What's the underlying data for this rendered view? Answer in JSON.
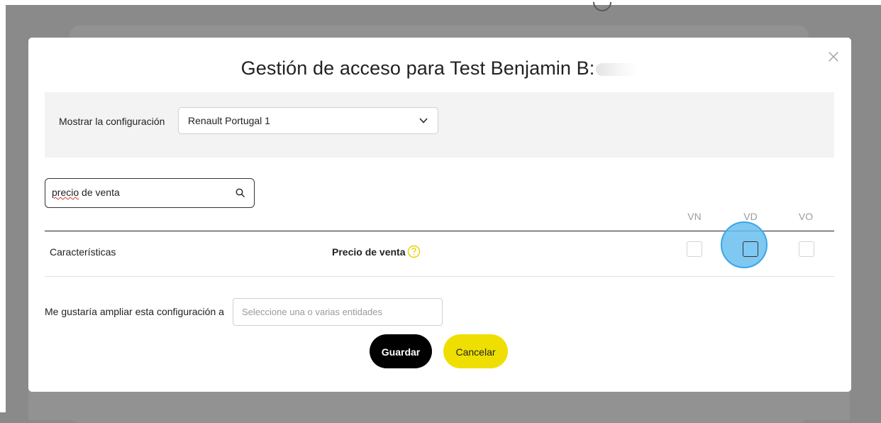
{
  "modal": {
    "title": "Gestión de acceso para Test Benjamin B:",
    "close_label": "×"
  },
  "config": {
    "label": "Mostrar la configuración",
    "selected": "Renault Portugal 1"
  },
  "search": {
    "misspelled_word": "precio",
    "rest": " de venta"
  },
  "table": {
    "columns": [
      "VN",
      "VD",
      "VO"
    ],
    "rows": [
      {
        "category": "Características",
        "name": "Precio de venta",
        "checked": {
          "VN": false,
          "VD": false,
          "VO": false
        }
      }
    ]
  },
  "extend": {
    "label": "Me gustaría ampliar esta configuración a",
    "placeholder": "Seleccione una o varias entidades"
  },
  "buttons": {
    "save": "Guardar",
    "cancel": "Cancelar"
  },
  "colors": {
    "accent_yellow": "#efdf00",
    "save_button": "#000000",
    "click_highlight": "#69bef0",
    "overlay": "#8a8a8a"
  },
  "icons": {
    "close": "close-icon",
    "chevron": "chevron-down-icon",
    "search": "search-icon",
    "help": "help-icon"
  }
}
